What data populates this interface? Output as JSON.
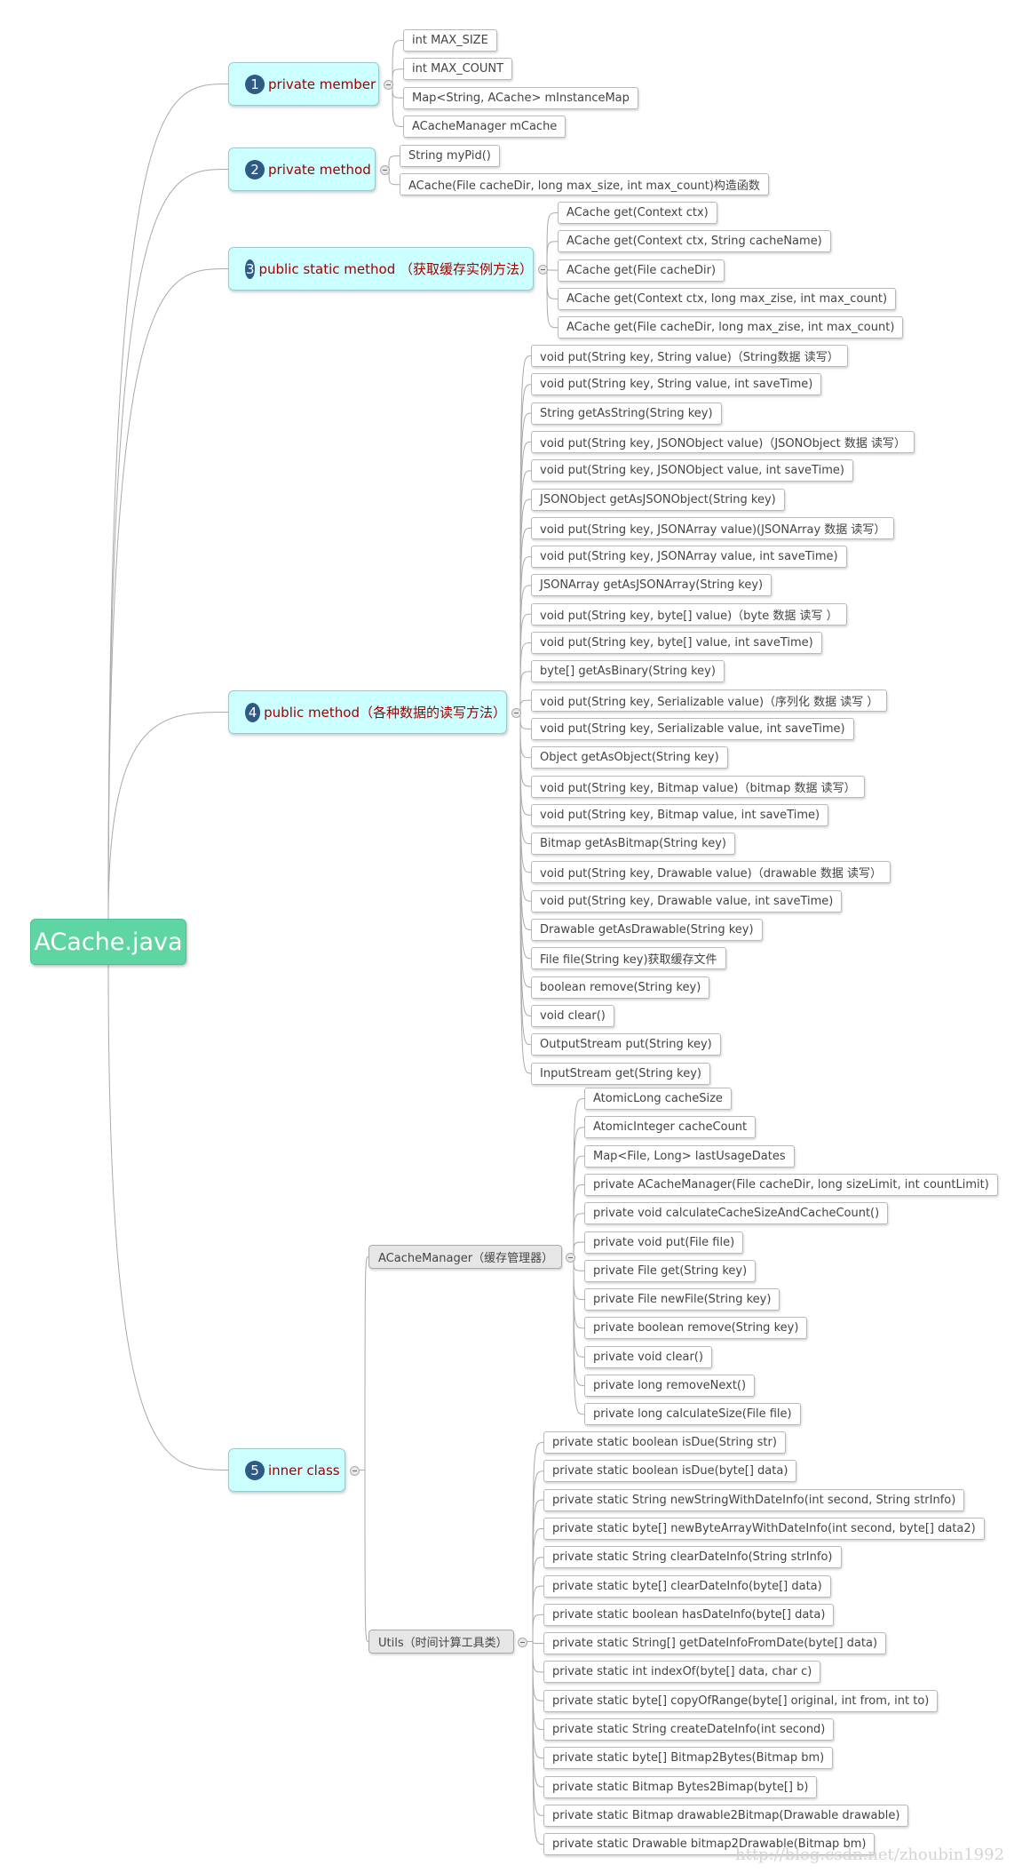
{
  "root": {
    "label": "ACache.java"
  },
  "colors": {
    "root": "#5fd5a4",
    "topic_bg": "#ccffff",
    "topic_text": "#a00000",
    "badge": "#2e5a84",
    "subtopic_bg": "#e6e6e6"
  },
  "branches": [
    {
      "number": "1",
      "label": "private member",
      "children": [
        "int MAX_SIZE",
        "int MAX_COUNT",
        "Map<String, ACache> mInstanceMap",
        "ACacheManager mCache"
      ]
    },
    {
      "number": "2",
      "label": "private method",
      "children": [
        "String myPid()",
        "ACache(File cacheDir, long max_size, int max_count)构造函数"
      ]
    },
    {
      "number": "3",
      "label": "public static method （获取缓存实例方法）",
      "children": [
        "ACache get(Context ctx)",
        "ACache get(Context ctx, String cacheName)",
        "ACache get(File cacheDir)",
        "ACache get(Context ctx, long max_zise, int max_count)",
        "ACache get(File cacheDir, long max_zise, int max_count)"
      ]
    },
    {
      "number": "4",
      "label": "public method（各种数据的读写方法）",
      "children": [
        "void put(String key, String value)（String数据 读写）",
        "void put(String key, String value, int saveTime)",
        "String getAsString(String key)",
        "void put(String key, JSONObject value)（JSONObject 数据 读写）",
        "void put(String key, JSONObject value, int saveTime)",
        "JSONObject getAsJSONObject(String key)",
        "void put(String key, JSONArray value)(JSONArray 数据 读写）",
        "void put(String key, JSONArray value, int saveTime)",
        "JSONArray getAsJSONArray(String key)",
        "void put(String key, byte[] value)（byte 数据 读写 ）",
        "void put(String key, byte[] value, int saveTime)",
        "byte[] getAsBinary(String key)",
        "void put(String key, Serializable value)（序列化 数据 读写 ）",
        "void put(String key, Serializable value, int saveTime)",
        "Object getAsObject(String key)",
        "void put(String key, Bitmap value)（bitmap 数据 读写）",
        "void put(String key, Bitmap value, int saveTime)",
        "Bitmap getAsBitmap(String key)",
        "void put(String key, Drawable value)（drawable 数据 读写）",
        "void put(String key, Drawable value, int saveTime)",
        "Drawable getAsDrawable(String key)",
        "File file(String key)获取缓存文件",
        "boolean remove(String key)",
        "void clear()",
        "OutputStream put(String key)",
        "InputStream get(String key)"
      ]
    },
    {
      "number": "5",
      "label": "inner class",
      "subtopics": [
        {
          "label": "ACacheManager（缓存管理器）",
          "children": [
            "AtomicLong cacheSize",
            "AtomicInteger cacheCount",
            "Map<File, Long> lastUsageDates",
            "private ACacheManager(File cacheDir, long sizeLimit, int countLimit)",
            "private void calculateCacheSizeAndCacheCount()",
            "private void put(File file)",
            "private File get(String key)",
            "private File newFile(String key)",
            "private boolean remove(String key)",
            "private void clear()",
            "private long removeNext()",
            "private long calculateSize(File file)"
          ]
        },
        {
          "label": "Utils（时间计算工具类）",
          "children": [
            "private static boolean isDue(String str)",
            "private static boolean isDue(byte[] data)",
            "private static String newStringWithDateInfo(int second, String strInfo)",
            "private static byte[] newByteArrayWithDateInfo(int second, byte[] data2)",
            "private static String clearDateInfo(String strInfo)",
            "private static byte[] clearDateInfo(byte[] data)",
            "private static boolean hasDateInfo(byte[] data)",
            "private static String[] getDateInfoFromDate(byte[] data)",
            "private static int indexOf(byte[] data, char c)",
            "private static byte[] copyOfRange(byte[] original, int from, int to)",
            "private static String createDateInfo(int second)",
            "private static byte[] Bitmap2Bytes(Bitmap bm)",
            "private static Bitmap Bytes2Bimap(byte[] b)",
            "private static Bitmap drawable2Bitmap(Drawable drawable)",
            "private static Drawable bitmap2Drawable(Bitmap bm)"
          ]
        }
      ]
    }
  ],
  "watermark": "http://blog.csdn.net/zhoubin1992"
}
